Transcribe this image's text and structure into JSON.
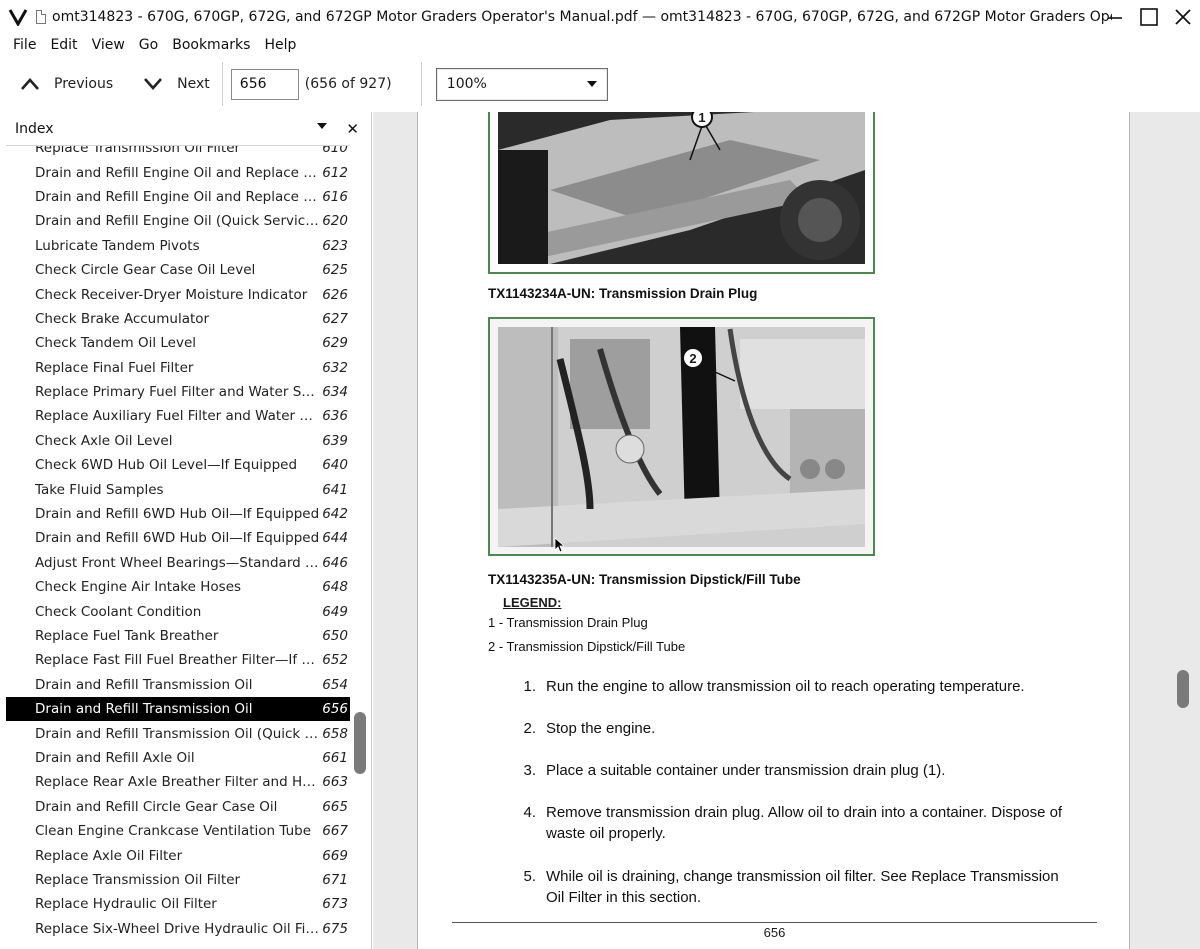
{
  "window": {
    "title": "omt314823 - 670G, 670GP, 672G, and 672GP Motor Graders Operator's Manual.pdf — omt314823 - 670G, 670GP, 672G, and 672GP Motor Graders Operator's Manual",
    "app_logo": "V"
  },
  "menu": [
    "File",
    "Edit",
    "View",
    "Go",
    "Bookmarks",
    "Help"
  ],
  "toolbar": {
    "previous_label": "Previous",
    "next_label": "Next",
    "page_value": "656",
    "page_count": "(656 of 927)",
    "zoom": "100%"
  },
  "sidebar": {
    "title": "Index",
    "items": [
      {
        "title": "Replace Transmission Oil Filter",
        "page": "610"
      },
      {
        "title": "Drain and Refill Engine Oil and Replace Filter",
        "page": "612"
      },
      {
        "title": "Drain and Refill Engine Oil and Replace Filter",
        "page": "616"
      },
      {
        "title": "Drain and Refill Engine Oil (Quick Service)—...",
        "page": "620"
      },
      {
        "title": "Lubricate Tandem Pivots",
        "page": "623"
      },
      {
        "title": "Check Circle Gear Case Oil Level",
        "page": "625"
      },
      {
        "title": "Check Receiver-Dryer Moisture Indicator",
        "page": "626"
      },
      {
        "title": "Check Brake Accumulator",
        "page": "627"
      },
      {
        "title": "Check Tandem Oil Level",
        "page": "629"
      },
      {
        "title": "Replace Final Fuel Filter",
        "page": "632"
      },
      {
        "title": "Replace Primary Fuel Filter and Water Sepa...",
        "page": "634"
      },
      {
        "title": "Replace Auxiliary Fuel Filter and Water Sepa...",
        "page": "636"
      },
      {
        "title": "Check Axle Oil Level",
        "page": "639"
      },
      {
        "title": "Check 6WD Hub Oil Level—If Equipped",
        "page": "640"
      },
      {
        "title": "Take Fluid Samples",
        "page": "641"
      },
      {
        "title": "Drain and Refill 6WD Hub Oil—If Equipped",
        "page": "642"
      },
      {
        "title": "Drain and Refill 6WD Hub Oil—If Equipped",
        "page": "644"
      },
      {
        "title": "Adjust Front Wheel Bearings—Standard Axl...",
        "page": "646"
      },
      {
        "title": "Check Engine Air Intake Hoses",
        "page": "648"
      },
      {
        "title": "Check Coolant Condition",
        "page": "649"
      },
      {
        "title": "Replace Fuel Tank Breather",
        "page": "650"
      },
      {
        "title": "Replace Fast Fill Fuel Breather Filter—If Eq...",
        "page": "652"
      },
      {
        "title": "Drain and Refill Transmission Oil",
        "page": "654"
      },
      {
        "title": "Drain and Refill Transmission Oil",
        "page": "656"
      },
      {
        "title": "Drain and Refill Transmission Oil (Quick Ser...",
        "page": "658"
      },
      {
        "title": "Drain and Refill Axle Oil",
        "page": "661"
      },
      {
        "title": "Replace Rear Axle Breather Filter and Hydra...",
        "page": "663"
      },
      {
        "title": "Drain and Refill Circle Gear Case Oil",
        "page": "665"
      },
      {
        "title": "Clean Engine Crankcase Ventilation Tube",
        "page": "667"
      },
      {
        "title": "Replace Axle Oil Filter",
        "page": "669"
      },
      {
        "title": "Replace Transmission Oil Filter",
        "page": "671"
      },
      {
        "title": "Replace Hydraulic Oil Filter",
        "page": "673"
      },
      {
        "title": "Replace Six-Wheel Drive Hydraulic Oil Filter...",
        "page": "675"
      }
    ],
    "selected_index": 23
  },
  "document": {
    "fig1_callout": "1",
    "fig1_caption": "TX1143234A-UN: Transmission Drain Plug",
    "fig2_callout": "2",
    "fig2_caption": "TX1143235A-UN: Transmission Dipstick/Fill Tube",
    "legend_title": "LEGEND:",
    "legend": [
      "1 - Transmission Drain Plug",
      "2 - Transmission Dipstick/Fill Tube"
    ],
    "steps": [
      {
        "n": "1.",
        "text": "Run the engine to allow transmission oil to reach operating temperature."
      },
      {
        "n": "2.",
        "text": "Stop the engine."
      },
      {
        "n": "3.",
        "text": "Place a suitable container under transmission drain plug (1)."
      },
      {
        "n": "4.",
        "text": "Remove transmission drain plug. Allow oil to drain into a container. Dispose of waste oil properly."
      },
      {
        "n": "5.",
        "text": "While oil is draining, change transmission oil filter. See Replace Transmission Oil Filter in this section."
      }
    ],
    "page_number": "656"
  }
}
